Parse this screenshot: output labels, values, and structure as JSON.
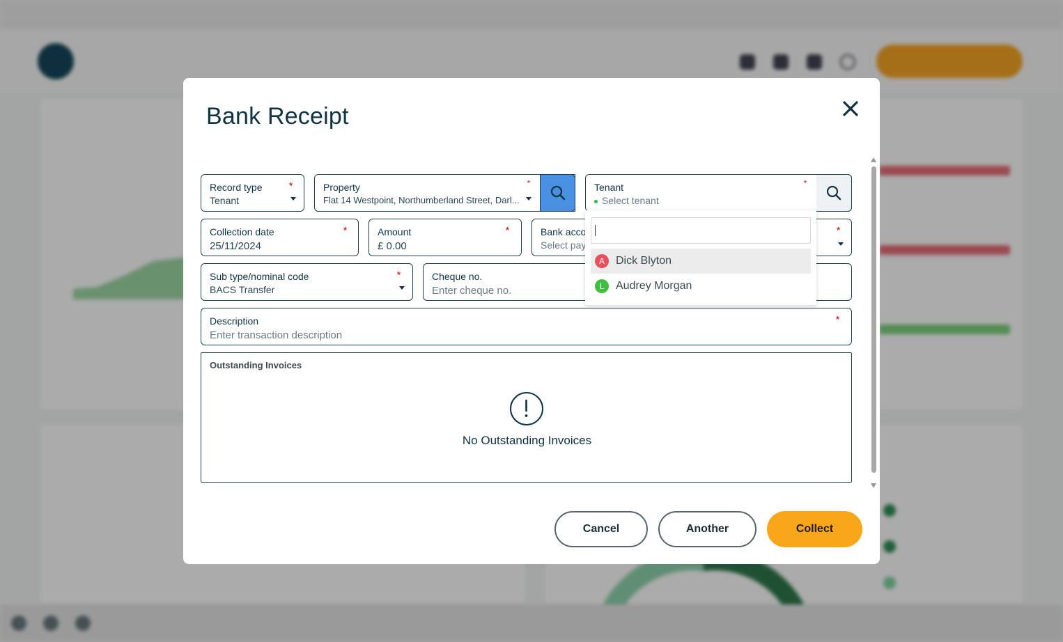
{
  "modal": {
    "title": "Bank Receipt",
    "fields": {
      "record_type": {
        "label": "Record type",
        "value": "Tenant",
        "required": "*"
      },
      "property": {
        "label": "Property",
        "value": "Flat 14 Westpoint, Northumberland Street, Darl...",
        "required": "*"
      },
      "tenant": {
        "label": "Tenant",
        "placeholder": "Select tenant",
        "required": "*"
      },
      "collection_date": {
        "label": "Collection date",
        "value": "25/11/2024",
        "required": "*"
      },
      "amount": {
        "label": "Amount",
        "value": "£ 0.00",
        "required": "*"
      },
      "bank_account": {
        "label": "Bank acco",
        "placeholder": "Select pay",
        "required": "*"
      },
      "sub_type": {
        "label": "Sub type/nominal code",
        "value": "BACS Transfer",
        "required": "*"
      },
      "cheque": {
        "label": "Cheque no.",
        "placeholder": "Enter cheque no."
      },
      "description": {
        "label": "Description",
        "placeholder": "Enter transaction description",
        "required": "*"
      }
    },
    "tenant_dropdown": {
      "search_value": "",
      "options": [
        {
          "initial": "A",
          "name": "Dick Blyton",
          "color": "#e8505b",
          "active": true
        },
        {
          "initial": "L",
          "name": "Audrey Morgan",
          "color": "#3fbf3f",
          "active": false
        }
      ]
    },
    "outstanding_invoices": {
      "title": "Outstanding Invoices",
      "empty_message": "No Outstanding Invoices",
      "icon": "exclamation-circle-icon"
    },
    "buttons": {
      "cancel": "Cancel",
      "another": "Another",
      "collect": "Collect"
    },
    "colors": {
      "primary": "#f9a61a",
      "search_active": "#4a90e2",
      "text": "#0f3340",
      "required": "#d32f2f"
    }
  }
}
